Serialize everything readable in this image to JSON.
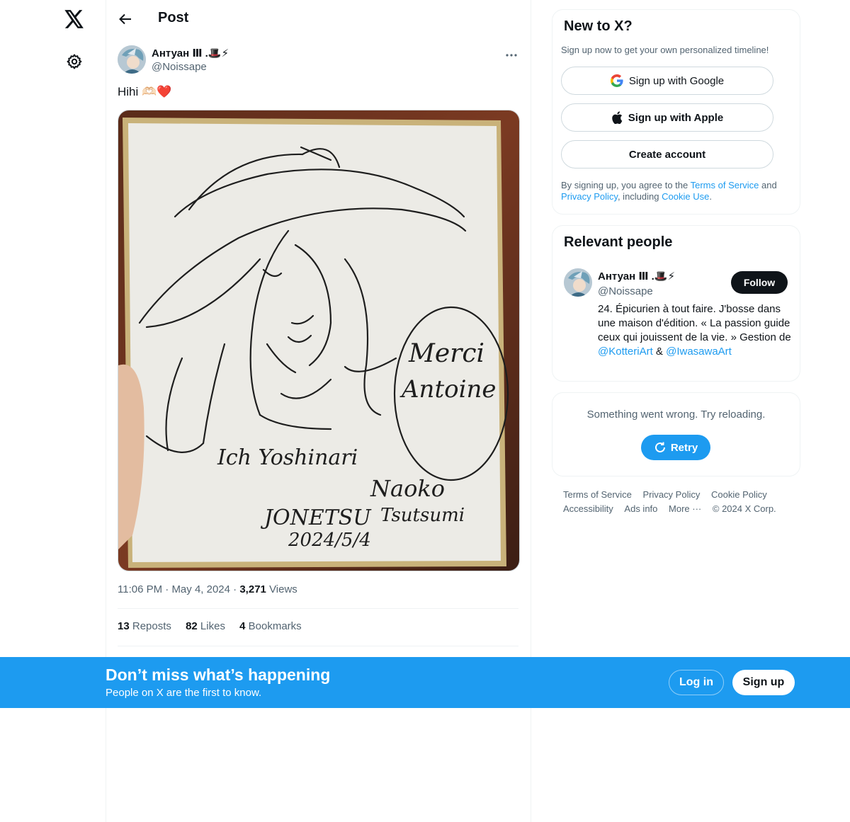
{
  "nav": {
    "logo": "x-logo-icon",
    "settings": "gear-icon"
  },
  "header": {
    "title": "Post",
    "back_icon": "arrow-left-icon"
  },
  "post": {
    "author_name": "Антуан Ⅲ .🎩⚡",
    "author_handle": "@Noissape",
    "more_icon": "ellipsis-icon",
    "text": "Hihi 🫶🏻❤️",
    "media": {
      "sketch_text": [
        "Merci",
        "Antoine",
        "Ich Yoshinari",
        "Naoko",
        "Tsutsumi",
        "JONETSU",
        "2024/5/4"
      ]
    },
    "time": "11:06 PM",
    "date": "May 4, 2024",
    "views_count": "3,271",
    "views_label": "Views",
    "reposts_count": "13",
    "reposts_label": "Reposts",
    "likes_count": "82",
    "likes_label": "Likes",
    "bookmarks_count": "4",
    "bookmarks_label": "Bookmarks"
  },
  "signup_card": {
    "title": "New to X?",
    "subtitle": "Sign up now to get your own personalized timeline!",
    "google_label": "Sign up with Google",
    "apple_label": "Sign up with Apple",
    "create_label": "Create account",
    "legal_pre": "By signing up, you agree to the ",
    "terms_link": "Terms of Service",
    "legal_and": " and ",
    "privacy_link": "Privacy Policy",
    "legal_including": ", including ",
    "cookie_link": "Cookie Use",
    "legal_end": "."
  },
  "relevant_people": {
    "title": "Relevant people",
    "name": "Антуан Ⅲ .🎩⚡",
    "handle": "@Noissape",
    "follow_label": "Follow",
    "bio_text": "24. Épicurien à tout faire. J'bosse dans une maison d'édition. « La passion guide ceux qui jouissent de la vie. » Gestion de ",
    "bio_link1": "@KotteriArt",
    "bio_amp": " & ",
    "bio_link2": "@IwasawaArt"
  },
  "error_card": {
    "message": "Something went wrong. Try reloading.",
    "retry_label": "Retry"
  },
  "footer": {
    "links": [
      "Terms of Service",
      "Privacy Policy",
      "Cookie Policy",
      "Accessibility",
      "Ads info",
      "More ···"
    ],
    "copyright": "© 2024 X Corp."
  },
  "banner": {
    "title": "Don’t miss what’s happening",
    "subtitle": "People on X are the first to know.",
    "login_label": "Log in",
    "signup_label": "Sign up"
  },
  "colors": {
    "accent": "#1d9bf0",
    "text": "#0f1419",
    "secondary": "#536471",
    "border": "#eff3f4"
  }
}
